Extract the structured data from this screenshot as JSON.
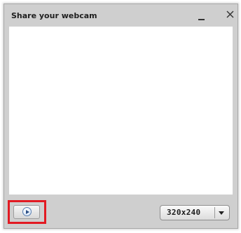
{
  "window": {
    "title": "Share your webcam",
    "minimize_icon": "minimize-icon",
    "close_icon": "close-icon"
  },
  "video_preview": {
    "state": "blank"
  },
  "controls": {
    "play_icon": "play-icon",
    "highlight_color": "#e21a22",
    "resolution": {
      "selected": "320x240"
    }
  }
}
